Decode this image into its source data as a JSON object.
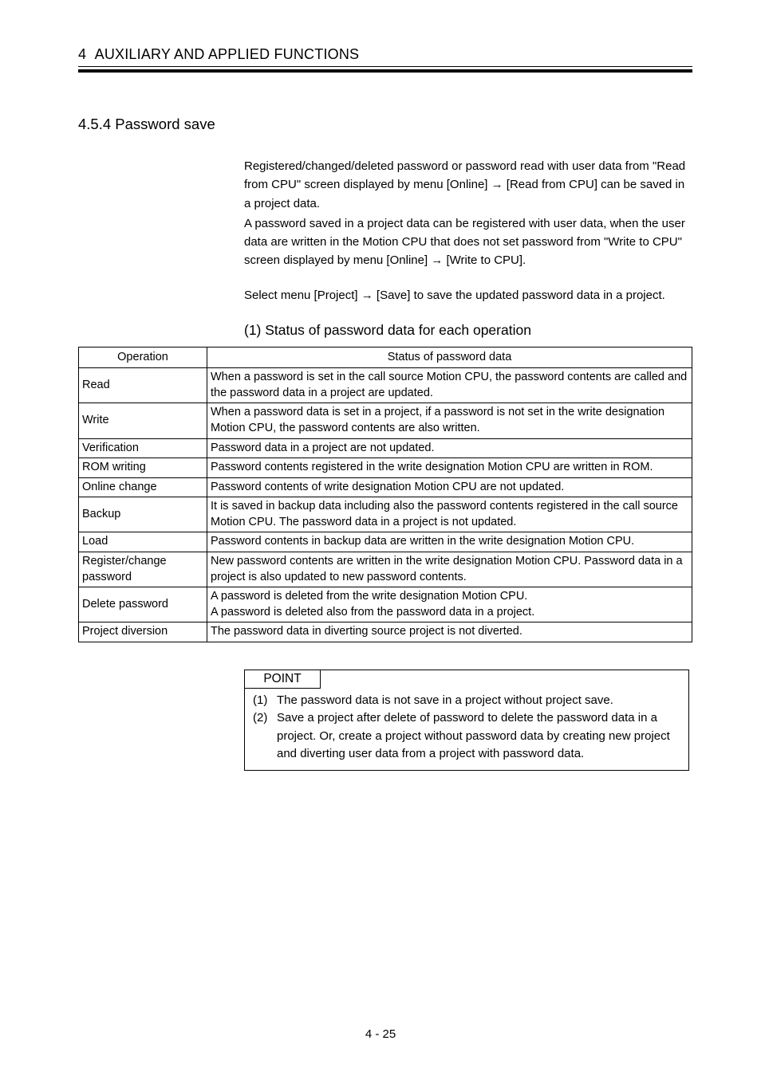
{
  "chapter": {
    "number": "4",
    "title": "AUXILIARY AND APPLIED FUNCTIONS"
  },
  "section": {
    "number": "4.5.4",
    "title": "Password save"
  },
  "body": {
    "para1": "Registered/changed/deleted password or password read with user data from \"Read from CPU\" screen displayed by menu [Online] → [Read from CPU] can be saved in a project data.",
    "para2": "A password saved in a project data can be registered with user data, when the user data are written in the Motion CPU that does not set password from \"Write to CPU\" screen displayed by menu [Online] → [Write to CPU].",
    "para3": "Select  menu [Project] → [Save] to save the updated password data in a project."
  },
  "subhead": "(1)  Status of password data for each operation",
  "table": {
    "headers": {
      "op": "Operation",
      "status": "Status of password data"
    },
    "rows": [
      {
        "op": "Read",
        "status": "When a password is set in the call source Motion CPU, the password contents are called and the password data in a project are updated."
      },
      {
        "op": "Write",
        "status": "When a password data is set in a project, if a password is not set in the write designation Motion CPU, the password contents are also written."
      },
      {
        "op": "Verification",
        "status": "Password data in a project are not updated."
      },
      {
        "op": "ROM writing",
        "status": "Password contents registered in the write designation Motion CPU are written in ROM."
      },
      {
        "op": "Online change",
        "status": "Password contents of write designation Motion CPU are not updated."
      },
      {
        "op": "Backup",
        "status": "It is saved in backup data including also the password contents registered in the call source Motion CPU. The password data in a project is not updated."
      },
      {
        "op": "Load",
        "status": "Password contents in backup data are written in the write designation Motion CPU."
      },
      {
        "op": "Register/change password",
        "status": "New password contents are written in the write designation Motion CPU. Password data in a project is also updated to new password contents."
      },
      {
        "op": "Delete password",
        "status": "A password is deleted from the write designation Motion CPU.\nA password is deleted also from the password data in a project."
      },
      {
        "op": "Project diversion",
        "status": "The password data in diverting source project is not diverted."
      }
    ]
  },
  "point": {
    "label": "POINT",
    "items": [
      {
        "num": "(1)",
        "text": "The password data is not save in a project without project save."
      },
      {
        "num": "(2)",
        "text": "Save a project after delete of password to delete the password data in a project. Or, create a project without password data by creating new project and diverting user data from a project with password data."
      }
    ]
  },
  "pageNumber": "4 - 25"
}
